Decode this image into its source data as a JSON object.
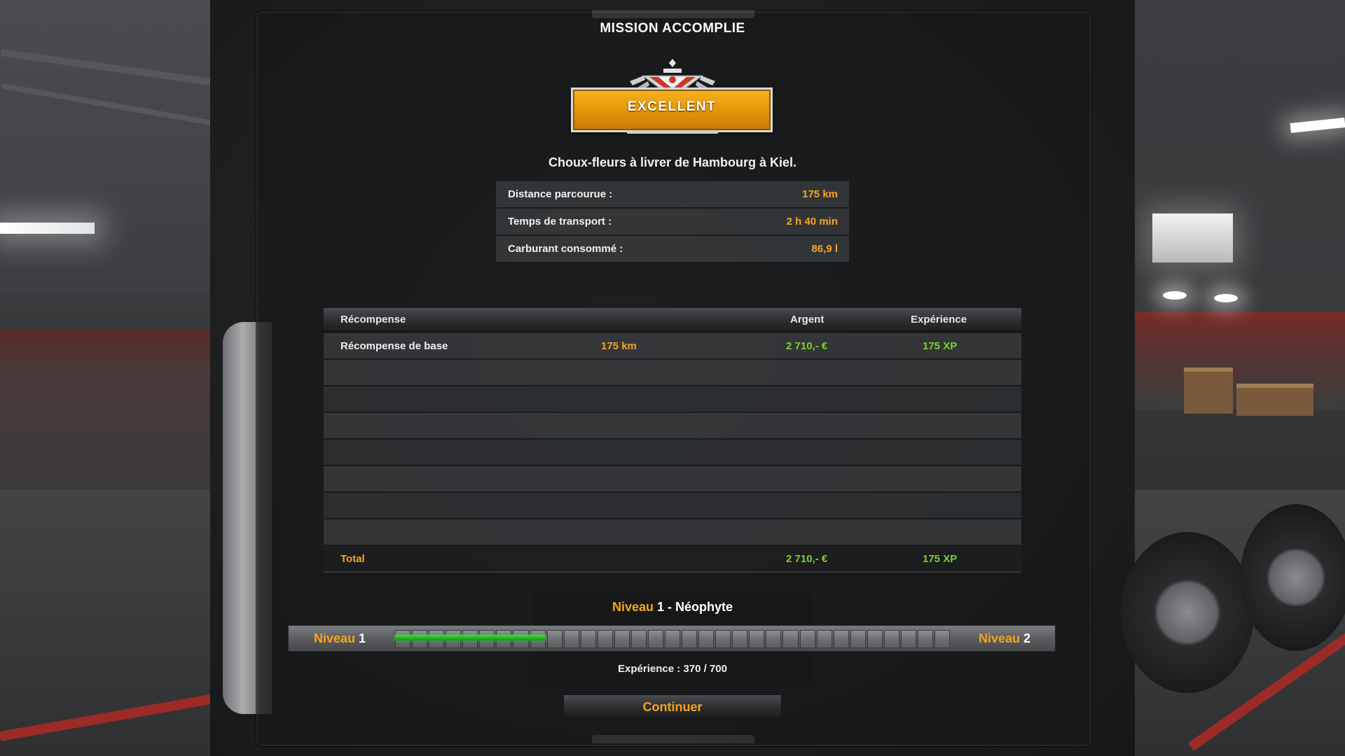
{
  "window": {
    "title": "MISSION ACCOMPLIE"
  },
  "badge": {
    "label": "EXCELLENT",
    "icon": "rating-emblem-icon",
    "color": "#f5a51d"
  },
  "subtitle": "Choux-fleurs à livrer de Hambourg à Kiel.",
  "stats": [
    {
      "label": "Distance parcourue :",
      "value": "175 km"
    },
    {
      "label": "Temps de transport :",
      "value": "2 h 40 min"
    },
    {
      "label": "Carburant consommé :",
      "value": "86,9 l"
    }
  ],
  "rewards": {
    "headers": {
      "name": "Récompense",
      "money": "Argent",
      "xp": "Expérience"
    },
    "rows": [
      {
        "name": "Récompense de base",
        "distance": "175 km",
        "money": "2 710,- €",
        "xp": "175 XP"
      }
    ],
    "empty_rows": 7,
    "total": {
      "label": "Total",
      "money": "2 710,- €",
      "xp": "175 XP"
    }
  },
  "level": {
    "title_word": "Niveau",
    "current": "1",
    "rank_suffix": " - Néophyte",
    "left_label_word": "Niveau",
    "left_number": "1",
    "right_label_word": "Niveau",
    "right_number": "2",
    "experience_text": "Expérience : 370 / 700",
    "progress_fraction": 0.2714,
    "segments": 33
  },
  "buttons": {
    "continue": "Continuer"
  },
  "colors": {
    "accent": "#f5a51d",
    "money_xp": "#79d42c",
    "progress": "#2fcf2f"
  }
}
